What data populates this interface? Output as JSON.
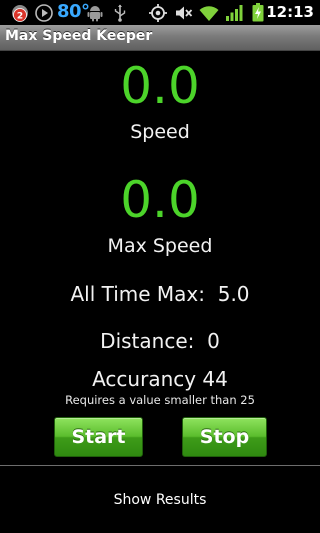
{
  "status_bar": {
    "notification_count": "2",
    "temperature": "80°",
    "time": "12:13",
    "icons": [
      "notification-badge-icon",
      "play-icon",
      "android-icon",
      "usb-icon",
      "gps-icon",
      "mute-icon",
      "wifi-icon",
      "signal-icon",
      "battery-charging-icon"
    ]
  },
  "app": {
    "title": "Max Speed Keeper"
  },
  "speed": {
    "value": "0.0",
    "label": "Speed"
  },
  "max_speed": {
    "value": "0.0",
    "label": "Max Speed"
  },
  "all_time_max": {
    "text": "All Time Max:  5.0"
  },
  "distance": {
    "text": "Distance:  0"
  },
  "accuracy": {
    "text": "Accurancy 44",
    "hint": "Requires a value smaller than 25"
  },
  "buttons": {
    "start_label": "Start",
    "stop_label": "Stop"
  },
  "footer": {
    "show_results_label": "Show Results"
  },
  "colors": {
    "value_green": "#4cd42a",
    "button_green": "#5bbd2d",
    "temp_blue": "#39a9ff",
    "background": "#000000"
  }
}
